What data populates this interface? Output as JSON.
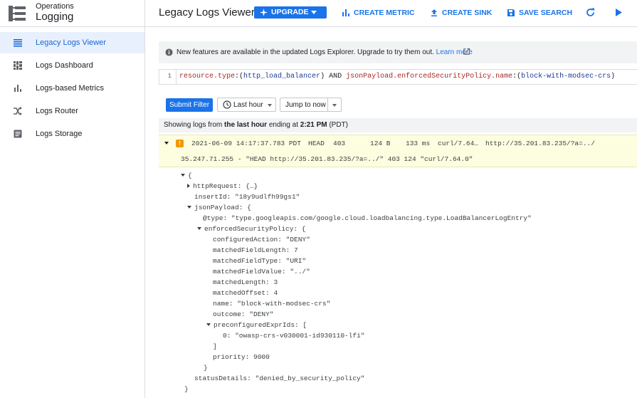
{
  "product": {
    "subtitle": "Operations",
    "name": "Logging"
  },
  "sidebar": {
    "items": [
      {
        "label": "Legacy Logs Viewer",
        "icon": "list-icon",
        "active": true
      },
      {
        "label": "Logs Dashboard",
        "icon": "dashboard-icon",
        "active": false
      },
      {
        "label": "Logs-based Metrics",
        "icon": "bar-chart-icon",
        "active": false
      },
      {
        "label": "Logs Router",
        "icon": "router-icon",
        "active": false
      },
      {
        "label": "Logs Storage",
        "icon": "storage-icon",
        "active": false
      }
    ]
  },
  "header": {
    "title": "Legacy Logs Viewer",
    "upgrade_label": "UPGRADE",
    "create_metric_label": "CREATE METRIC",
    "create_sink_label": "CREATE SINK",
    "save_search_label": "SAVE SEARCH"
  },
  "banner": {
    "message": "New features are available in the updated Logs Explorer. Upgrade to try them out.",
    "link": "Learn more"
  },
  "query": {
    "line_number": "1",
    "parts": [
      {
        "text": "resource.type",
        "kind": "key"
      },
      {
        "text": ":(",
        "kind": "op"
      },
      {
        "text": "http_load_balancer",
        "kind": "val"
      },
      {
        "text": ") AND ",
        "kind": "op"
      },
      {
        "text": "jsonPayload.enforcedSecurityPolicy.name",
        "kind": "key"
      },
      {
        "text": ":(",
        "kind": "op"
      },
      {
        "text": "block-with-modsec-crs",
        "kind": "val"
      },
      {
        "text": ")",
        "kind": "op"
      }
    ]
  },
  "controls": {
    "submit_label": "Submit Filter",
    "time_range": "Last hour",
    "jump_label": "Jump to now"
  },
  "status": {
    "prefix": "Showing logs from ",
    "range": "the last hour",
    "mid": " ending at ",
    "time": "2:21 PM",
    "suffix": " (PDT)"
  },
  "entry": {
    "severity_icon": "!",
    "timestamp": "2021-06-09 14:17:37.783 PDT",
    "method": "HEAD",
    "status": "403",
    "size": "124 B",
    "latency": "133 ms",
    "user_agent": "curl/7.64…",
    "url": "http://35.201.83.235/?a=../",
    "summary": "35.247.71.255 - \"HEAD http://35.201.83.235/?a=../\" 403 124 \"curl/7.64.0\""
  },
  "tree": [
    {
      "text": "{",
      "toggle": "down"
    },
    {
      "text": "httpRequest: {…}",
      "toggle": "right"
    },
    {
      "text": "insertId: \"18y9udlfh99gs1\"",
      "toggle": ""
    },
    {
      "text": "jsonPayload: {",
      "toggle": "down"
    },
    {
      "text": "@type: \"type.googleapis.com/google.cloud.loadbalancing.type.LoadBalancerLogEntry\"",
      "toggle": ""
    },
    {
      "text": "enforcedSecurityPolicy: {",
      "toggle": "down"
    },
    {
      "text": "configuredAction: \"DENY\"",
      "toggle": ""
    },
    {
      "text": "matchedFieldLength: 7",
      "toggle": ""
    },
    {
      "text": "matchedFieldType: \"URI\"",
      "toggle": ""
    },
    {
      "text": "matchedFieldValue: \"../\"",
      "toggle": ""
    },
    {
      "text": "matchedLength: 3",
      "toggle": ""
    },
    {
      "text": "matchedOffset: 4",
      "toggle": ""
    },
    {
      "text": "name: \"block-with-modsec-crs\"",
      "toggle": ""
    },
    {
      "text": "outcome: \"DENY\"",
      "toggle": ""
    },
    {
      "text": "preconfiguredExprIds: [",
      "toggle": "down"
    },
    {
      "text": "0: \"owasp-crs-v030001-id930110-lfi\"",
      "toggle": ""
    },
    {
      "text": "]",
      "toggle": ""
    },
    {
      "text": "priority: 9000",
      "toggle": ""
    },
    {
      "text": "}",
      "toggle": ""
    },
    {
      "text": "statusDetails: \"denied_by_security_policy\"",
      "toggle": ""
    },
    {
      "text": "}",
      "toggle": ""
    }
  ]
}
